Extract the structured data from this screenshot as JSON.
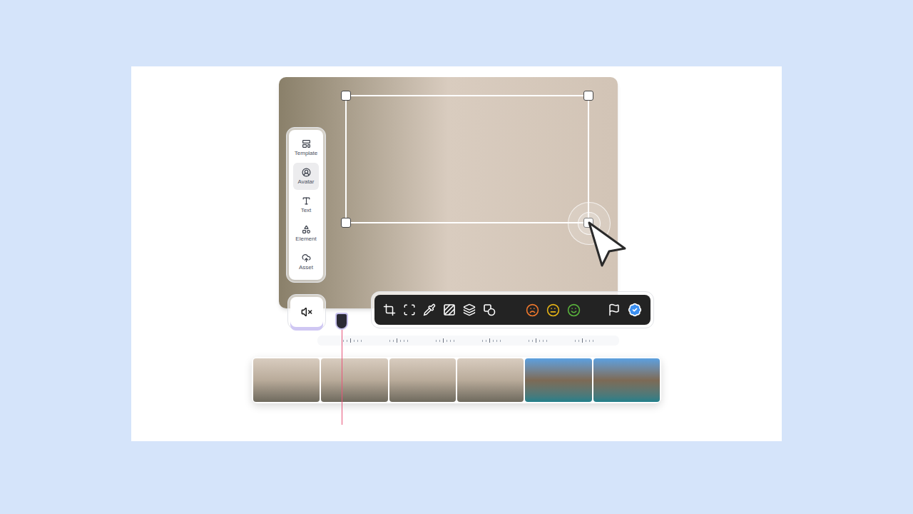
{
  "sidebar": {
    "items": [
      {
        "label": "Template",
        "selected": false
      },
      {
        "label": "Avatar",
        "selected": true
      },
      {
        "label": "Text",
        "selected": false
      },
      {
        "label": "Element",
        "selected": false
      },
      {
        "label": "Asset",
        "selected": false
      }
    ]
  },
  "audio": {
    "muted": true
  },
  "canvas": {
    "selected": true
  },
  "toolbar": {
    "reactions": [
      {
        "kind": "frown",
        "color": "#f0782d"
      },
      {
        "kind": "meh",
        "color": "#e6b416"
      },
      {
        "kind": "smile",
        "color": "#5ab43c"
      }
    ],
    "verified": true
  },
  "timeline": {
    "playhead": {
      "level": 0.22
    },
    "clips": [
      {
        "kind": "avatar"
      },
      {
        "kind": "avatar"
      },
      {
        "kind": "avatar"
      },
      {
        "kind": "avatar"
      },
      {
        "kind": "scene"
      },
      {
        "kind": "scene"
      }
    ]
  }
}
